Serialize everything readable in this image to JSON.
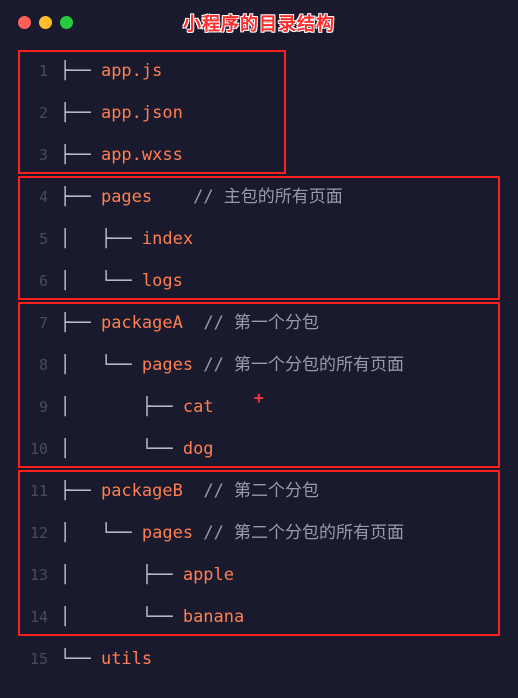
{
  "title": "小程序的目录结构",
  "lines": [
    {
      "n": "1",
      "segs": [
        {
          "t": "├── ",
          "c": "tree"
        },
        {
          "t": "app",
          "c": "kw"
        },
        {
          "t": ".",
          "c": "punct"
        },
        {
          "t": "js",
          "c": "kw"
        }
      ]
    },
    {
      "n": "2",
      "segs": [
        {
          "t": "├── ",
          "c": "tree"
        },
        {
          "t": "app",
          "c": "kw"
        },
        {
          "t": ".",
          "c": "punct"
        },
        {
          "t": "json",
          "c": "kw"
        }
      ]
    },
    {
      "n": "3",
      "segs": [
        {
          "t": "├── ",
          "c": "tree"
        },
        {
          "t": "app",
          "c": "kw"
        },
        {
          "t": ".",
          "c": "punct"
        },
        {
          "t": "wxss",
          "c": "kw"
        }
      ]
    },
    {
      "n": "4",
      "segs": [
        {
          "t": "├── ",
          "c": "tree"
        },
        {
          "t": "pages",
          "c": "kw"
        },
        {
          "t": "    ",
          "c": "plain"
        },
        {
          "t": "// 主包的所有页面",
          "c": "comment"
        }
      ]
    },
    {
      "n": "5",
      "segs": [
        {
          "t": "│   ├── ",
          "c": "tree"
        },
        {
          "t": "index",
          "c": "kw"
        }
      ]
    },
    {
      "n": "6",
      "segs": [
        {
          "t": "│   └── ",
          "c": "tree"
        },
        {
          "t": "logs",
          "c": "kw"
        }
      ]
    },
    {
      "n": "7",
      "segs": [
        {
          "t": "├── ",
          "c": "tree"
        },
        {
          "t": "packageA",
          "c": "kw"
        },
        {
          "t": "  ",
          "c": "plain"
        },
        {
          "t": "// 第一个分包",
          "c": "comment"
        }
      ]
    },
    {
      "n": "8",
      "segs": [
        {
          "t": "│   └── ",
          "c": "tree"
        },
        {
          "t": "pages",
          "c": "kw"
        },
        {
          "t": " ",
          "c": "plain"
        },
        {
          "t": "// 第一个分包的所有页面",
          "c": "comment"
        }
      ]
    },
    {
      "n": "9",
      "segs": [
        {
          "t": "│       ├── ",
          "c": "tree"
        },
        {
          "t": "cat",
          "c": "kw"
        }
      ]
    },
    {
      "n": "10",
      "segs": [
        {
          "t": "│       └── ",
          "c": "tree"
        },
        {
          "t": "dog",
          "c": "kw"
        }
      ]
    },
    {
      "n": "11",
      "segs": [
        {
          "t": "├── ",
          "c": "tree"
        },
        {
          "t": "packageB",
          "c": "kw"
        },
        {
          "t": "  ",
          "c": "plain"
        },
        {
          "t": "// 第二个分包",
          "c": "comment"
        }
      ]
    },
    {
      "n": "12",
      "segs": [
        {
          "t": "│   └── ",
          "c": "tree"
        },
        {
          "t": "pages",
          "c": "kw"
        },
        {
          "t": " ",
          "c": "plain"
        },
        {
          "t": "// 第二个分包的所有页面",
          "c": "comment"
        }
      ]
    },
    {
      "n": "13",
      "segs": [
        {
          "t": "│       ├── ",
          "c": "tree"
        },
        {
          "t": "apple",
          "c": "kw"
        }
      ]
    },
    {
      "n": "14",
      "segs": [
        {
          "t": "│       └── ",
          "c": "tree"
        },
        {
          "t": "banana",
          "c": "kw"
        }
      ]
    },
    {
      "n": "15",
      "segs": [
        {
          "t": "└── ",
          "c": "tree"
        },
        {
          "t": "utils",
          "c": "kw"
        }
      ]
    }
  ],
  "plus": "+"
}
